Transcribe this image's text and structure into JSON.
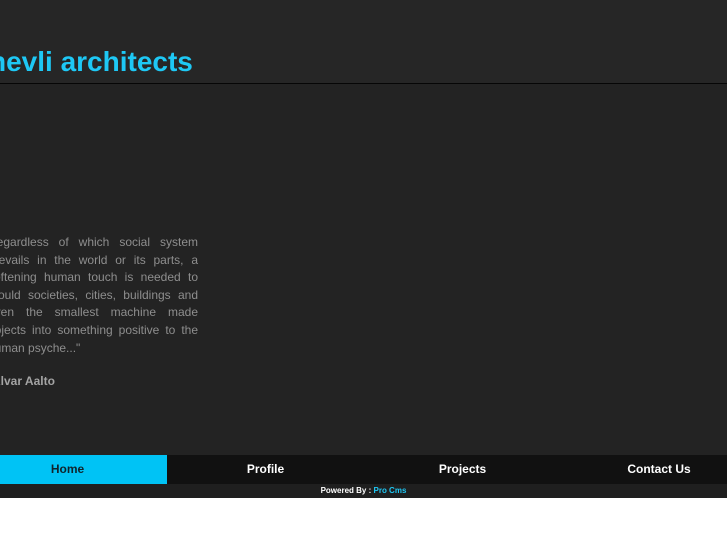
{
  "header": {
    "title": "hevli architects"
  },
  "quote": {
    "text": "Regardless of which social system prevails in the world or its parts, a softening human touch is needed to mould societies, cities, buildings and even the smallest machine made objects into something positive to the human psyche...\"",
    "author": "Alvar Aalto"
  },
  "nav": {
    "items": [
      {
        "label": "Home",
        "active": true
      },
      {
        "label": "Profile",
        "active": false
      },
      {
        "label": "Projects",
        "active": false
      },
      {
        "label": "Contact Us",
        "active": false
      }
    ]
  },
  "footer": {
    "prefix": "Powered By :",
    "link": "Pro Cms"
  },
  "colors": {
    "accent": "#00c3f5",
    "title": "#1ec8f5",
    "background": "#232323"
  }
}
